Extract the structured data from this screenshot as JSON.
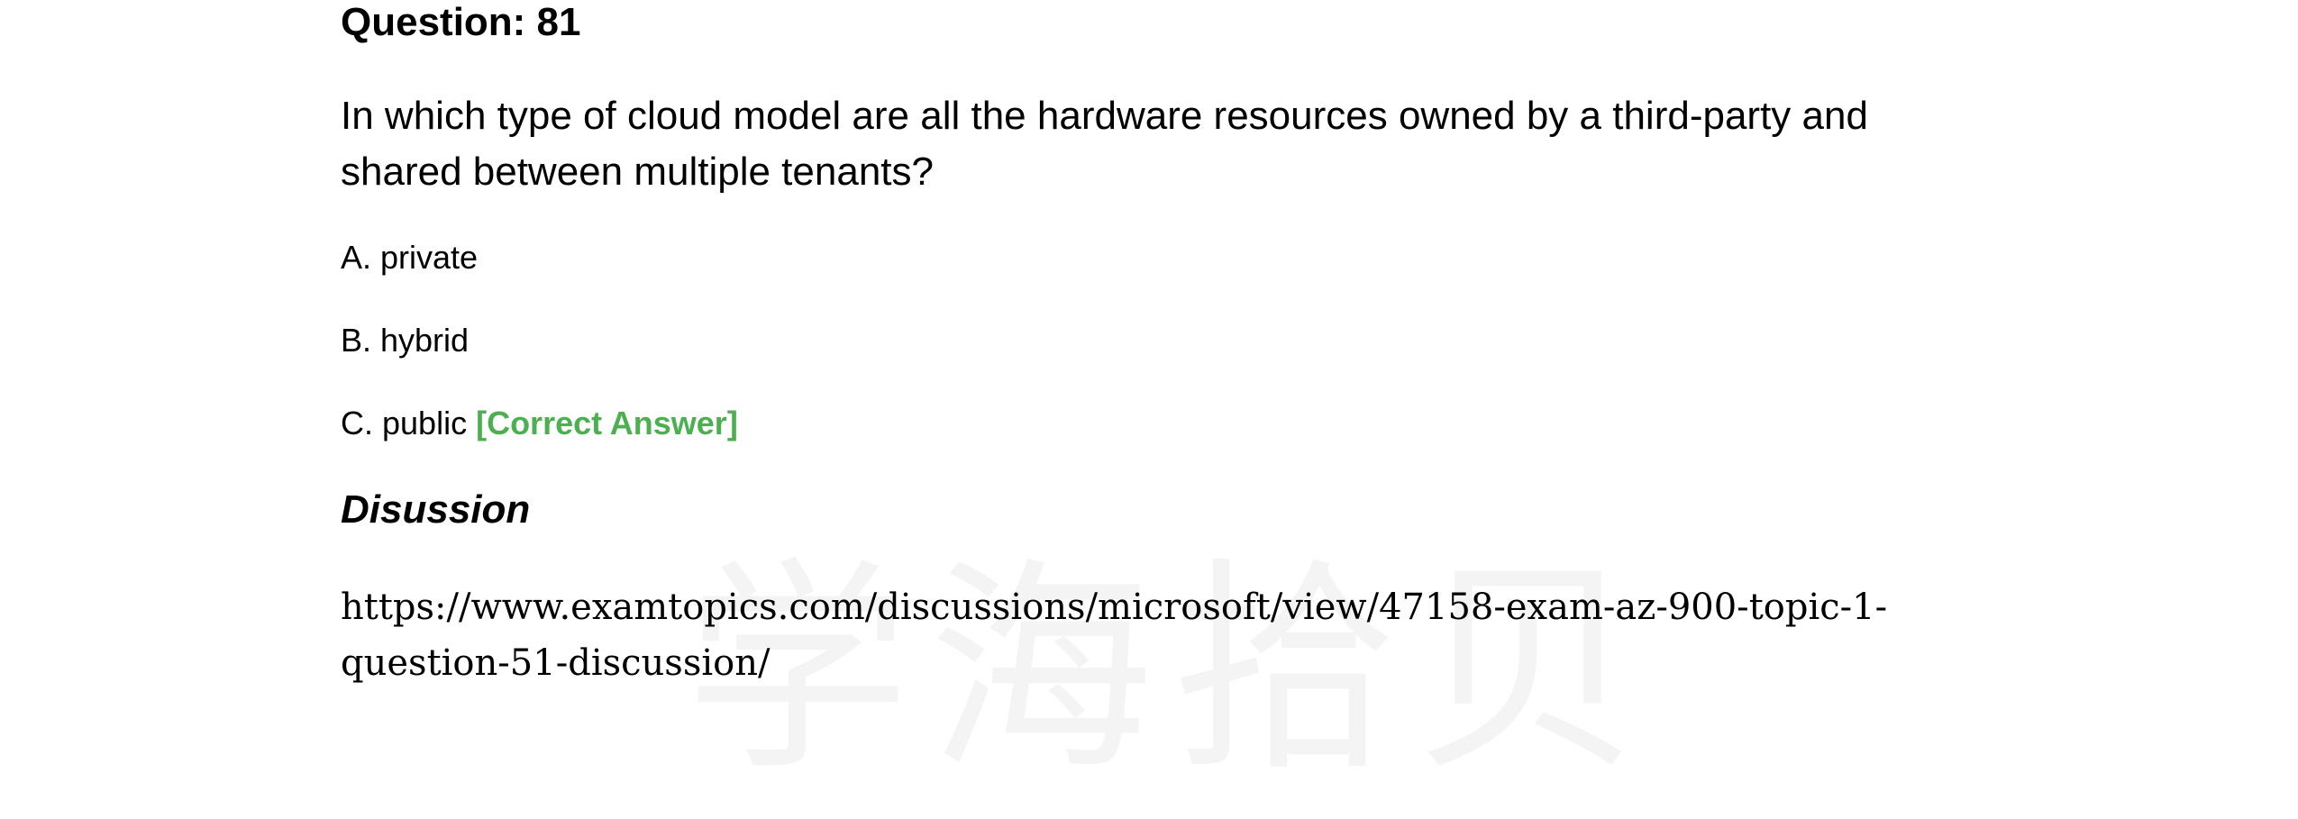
{
  "watermark": "学海拾贝",
  "question": {
    "title": "Question: 81",
    "text": "In which type of cloud model are all the hardware resources owned by a third-party and shared between multiple tenants?"
  },
  "options": [
    {
      "label": "A. private"
    },
    {
      "label": "B. hybrid"
    },
    {
      "label": "C. public",
      "tag": "[Correct Answer]"
    }
  ],
  "discussion": {
    "heading": "Disussion",
    "link_line1": "https://www.examtopics.com/discussions/microsoft/view/47158-exam-az-900-topic-1-",
    "link_line2": "question-51-discussion/"
  },
  "colors": {
    "correct_answer": "#4caf50"
  }
}
